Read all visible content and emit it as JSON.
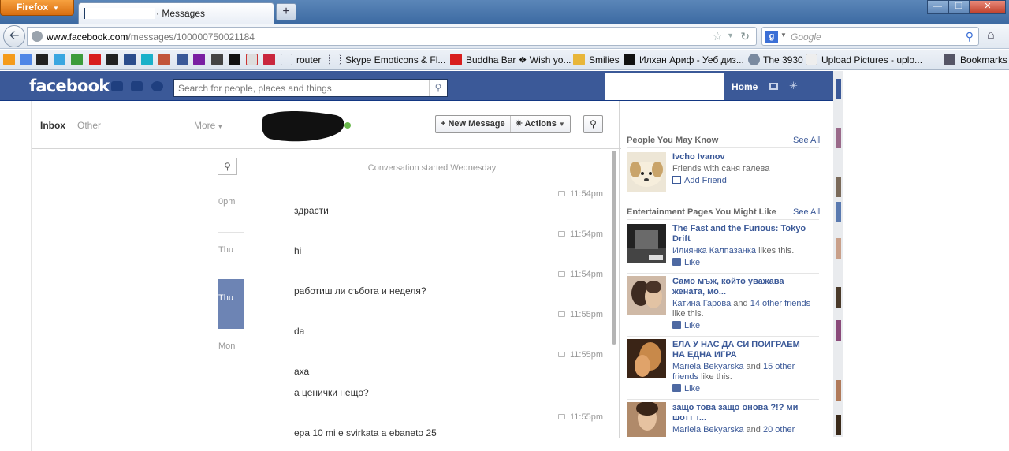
{
  "browser": {
    "app_button": "Firefox",
    "tab_title": "· Messages",
    "url_host": "www.facebook.com",
    "url_path": "/messages/100000750021184",
    "search_placeholder": "Google",
    "bookmarks": [
      {
        "label": "router"
      },
      {
        "label": "Skype Emoticons & Fl..."
      },
      {
        "label": "Buddha Bar ❖ Wish yo..."
      },
      {
        "label": "Smilies"
      },
      {
        "label": "Илхан Ариф - Уеб диз..."
      },
      {
        "label": "The 3930"
      },
      {
        "label": "Upload Pictures - uplo..."
      },
      {
        "label": "Bookmarks"
      }
    ]
  },
  "facebook": {
    "logo": "facebook",
    "search_placeholder": "Search for people, places and things",
    "home": "Home"
  },
  "inbox": {
    "inbox_label": "Inbox",
    "other_label": "Other",
    "more_label": "More",
    "thread_times": [
      "0pm",
      "Thu",
      "Thu",
      "Mon"
    ]
  },
  "conversation": {
    "new_message": "New Message",
    "actions": "Actions",
    "started": "Conversation started Wednesday",
    "messages": [
      {
        "time": "11:54pm",
        "text": "здрасти"
      },
      {
        "time": "11:54pm",
        "text": "hi"
      },
      {
        "time": "11:54pm",
        "text": "работиш ли събота и неделя?"
      },
      {
        "time": "11:55pm",
        "text": "da"
      },
      {
        "time": "11:55pm",
        "text": "аха",
        "text2": "а ценички нещо?"
      },
      {
        "time": "11:55pm",
        "text": "ера 10 mi e svirkata a ebaneto 25"
      }
    ]
  },
  "sidebar": {
    "pymk_title": "People You May Know",
    "see_all": "See All",
    "pymk": {
      "name": "Ivcho Ivanov",
      "friends_with": "Friends with саня галева",
      "action": "Add Friend"
    },
    "pages_title": "Entertainment Pages You Might Like",
    "pages": [
      {
        "name": "The Fast and the Furious: Tokyo Drift",
        "liker": "Илиянка Калпазанка",
        "liker_suffix": " likes this.",
        "action": "Like"
      },
      {
        "name": "Само мъж, който уважава жената, мо...",
        "liker": "Катина Гарова",
        "mid": " and ",
        "others": "14 other friends",
        "liker_suffix": "like this.",
        "action": "Like"
      },
      {
        "name": "ЕЛА У НАС ДА СИ ПОИГРАЕМ НА ЕДНА ИГРА",
        "liker": "Mariela Bekyarska",
        "mid": " and ",
        "others": "15 other friends",
        "liker_suffix": " like this.",
        "action": "Like"
      },
      {
        "name": "защо това защо онова ?!? ми шотт т...",
        "liker": "Mariela Bekyarska",
        "mid": " and ",
        "others": "20 other"
      }
    ]
  }
}
